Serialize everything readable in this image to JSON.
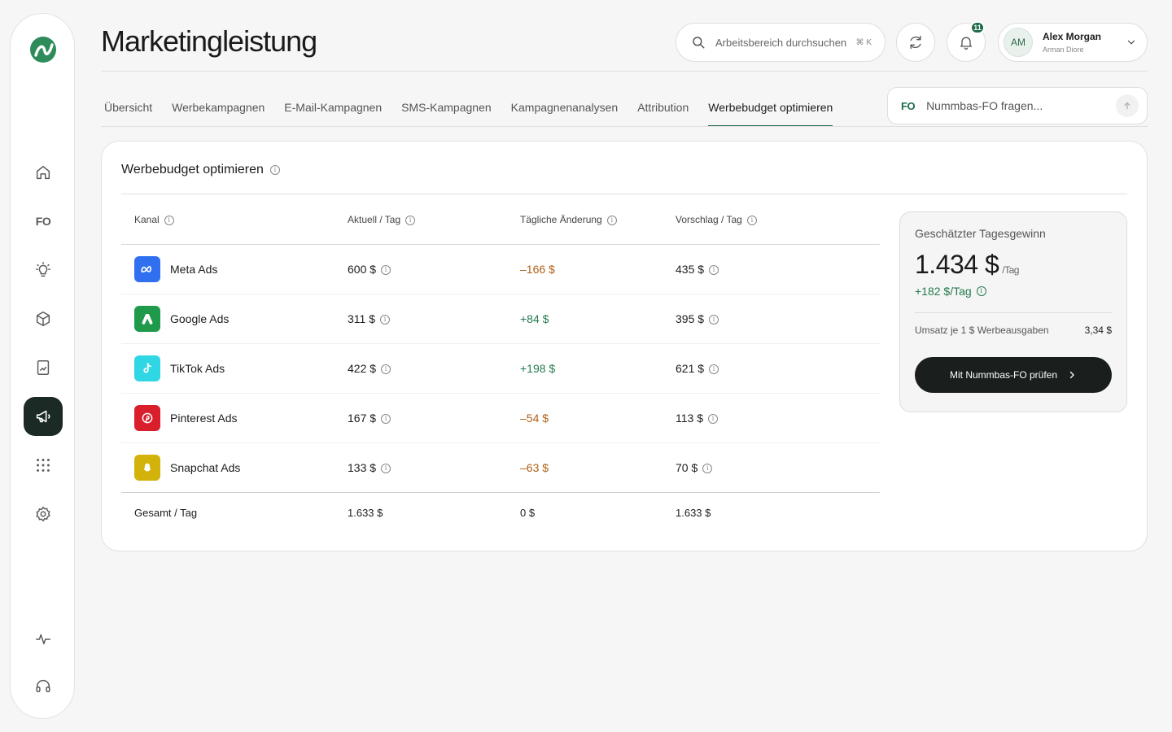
{
  "page": {
    "title": "Marketingleistung"
  },
  "search": {
    "placeholder": "Arbeitsbereich durchsuchen",
    "shortcut": "⌘ K"
  },
  "notifications": {
    "count": "11"
  },
  "user": {
    "initials": "AM",
    "name": "Alex Morgan",
    "subtitle": "Arman Diore"
  },
  "sidebar": {
    "items": [
      {
        "name": "home-icon"
      },
      {
        "name": "fo-icon",
        "label": "FO"
      },
      {
        "name": "lightbulb-icon"
      },
      {
        "name": "box-icon"
      },
      {
        "name": "report-icon"
      },
      {
        "name": "megaphone-icon",
        "active": true
      },
      {
        "name": "apps-grid-icon"
      },
      {
        "name": "settings-icon"
      },
      {
        "name": "activity-icon"
      },
      {
        "name": "headset-icon"
      }
    ]
  },
  "tabs": [
    {
      "label": "Übersicht"
    },
    {
      "label": "Werbekampagnen"
    },
    {
      "label": "E-Mail-Kampagnen"
    },
    {
      "label": "SMS-Kampagnen"
    },
    {
      "label": "Kampagnenanalysen"
    },
    {
      "label": "Attribution"
    },
    {
      "label": "Werbebudget optimieren",
      "active": true
    }
  ],
  "ask": {
    "prefix": "FO",
    "placeholder": "Nummbas-FO fragen..."
  },
  "card": {
    "title": "Werbebudget optimieren",
    "columns": [
      "Kanal",
      "Aktuell / Tag",
      "Tägliche Änderung",
      "Vorschlag / Tag"
    ],
    "rows": [
      {
        "channel": "Meta Ads",
        "current": "600 $",
        "change": "–166 $",
        "suggest": "435 $",
        "color": "#2f6ff0"
      },
      {
        "channel": "Google Ads",
        "current": "311 $",
        "change": "+84 $",
        "suggest": "395 $",
        "color": "#1f9a4a"
      },
      {
        "channel": "TikTok Ads",
        "current": "422 $",
        "change": "+198 $",
        "suggest": "621 $",
        "color": "#2fd6e3"
      },
      {
        "channel": "Pinterest Ads",
        "current": "167 $",
        "change": "–54 $",
        "suggest": "113 $",
        "color": "#d91f2c"
      },
      {
        "channel": "Snapchat Ads",
        "current": "133 $",
        "change": "–63 $",
        "suggest": "70 $",
        "color": "#d4b20c"
      }
    ],
    "total": {
      "label": "Gesamt / Tag",
      "current": "1.633 $",
      "change": "0 $",
      "suggest": "1.633 $"
    }
  },
  "profit": {
    "label": "Geschätzter Tagesgewinn",
    "value": "1.434 $",
    "unit": "/Tag",
    "delta": "+182 $/Tag",
    "metric_label": "Umsatz je 1 $ Werbeausgaben",
    "metric_value": "3,34 $",
    "cta": "Mit Nummbas-FO prüfen"
  }
}
